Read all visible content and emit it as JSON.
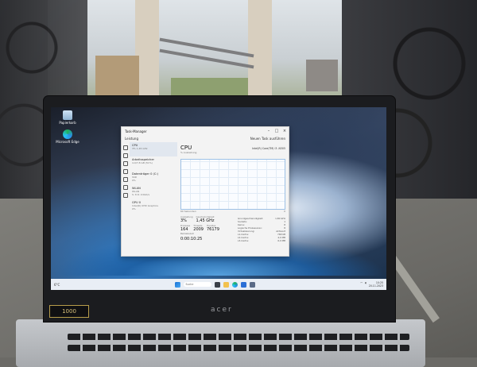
{
  "laptop": {
    "brand": "acer",
    "sticker": "1000"
  },
  "desktop": {
    "icons": [
      {
        "label": "Papierkorb",
        "icon": "recycle-bin-icon"
      },
      {
        "label": "Microsoft Edge",
        "icon": "edge-icon"
      }
    ]
  },
  "task_manager": {
    "title": "Task-Manager",
    "toolbar_left": "Leistung",
    "toolbar_right": "Neuen Task ausführen",
    "nav_items": [
      {
        "label": "CPU",
        "sub": "3% 1,45 GHz",
        "selected": true
      },
      {
        "label": "Arbeitsspeicher",
        "sub": "4,0/7,8 GB (51%)"
      },
      {
        "label": "Datenträger 0 (C:)",
        "sub": "SSD",
        "sub2": "0%"
      },
      {
        "label": "WLAN",
        "sub": "WLAN",
        "sub2": "S: 8 R: 0 Kbit/s"
      },
      {
        "label": "GPU 0",
        "sub": "Intel(R) UHD Graphics",
        "sub2": "0%"
      }
    ],
    "detail": {
      "title": "CPU",
      "subtitle": "% Auslastung",
      "model": "Intel(R) Core(TM) i3 -N305",
      "graph_left": "60 Sekunden",
      "graph_right": "0",
      "stats": [
        {
          "label": "Auslastung",
          "value": "3%"
        },
        {
          "label": "Geschwindigkeit",
          "value": "1,45 GHz"
        }
      ],
      "stats2": [
        {
          "label": "Prozesse",
          "value": "164"
        },
        {
          "label": "Threads",
          "value": "2009"
        },
        {
          "label": "Handles",
          "value": "76179"
        }
      ],
      "uptime_label": "Betriebszeit",
      "uptime": "0:00:10:25",
      "properties": [
        {
          "k": "Grundgeschwindigkeit:",
          "v": "1,80 GHz"
        },
        {
          "k": "Sockets:",
          "v": "1"
        },
        {
          "k": "Kerne:",
          "v": "8"
        },
        {
          "k": "Logische Prozessoren:",
          "v": "8"
        },
        {
          "k": "Virtualisierung:",
          "v": "Aktiviert"
        },
        {
          "k": "L1-Cache:",
          "v": "768 KB"
        },
        {
          "k": "L2-Cache:",
          "v": "4,0 MB"
        },
        {
          "k": "L3-Cache:",
          "v": "6,0 MB"
        }
      ]
    }
  },
  "taskbar": {
    "weather": "6°C",
    "search_placeholder": "Suche",
    "clock_time": "10:25",
    "clock_date": "20.11.2023"
  }
}
